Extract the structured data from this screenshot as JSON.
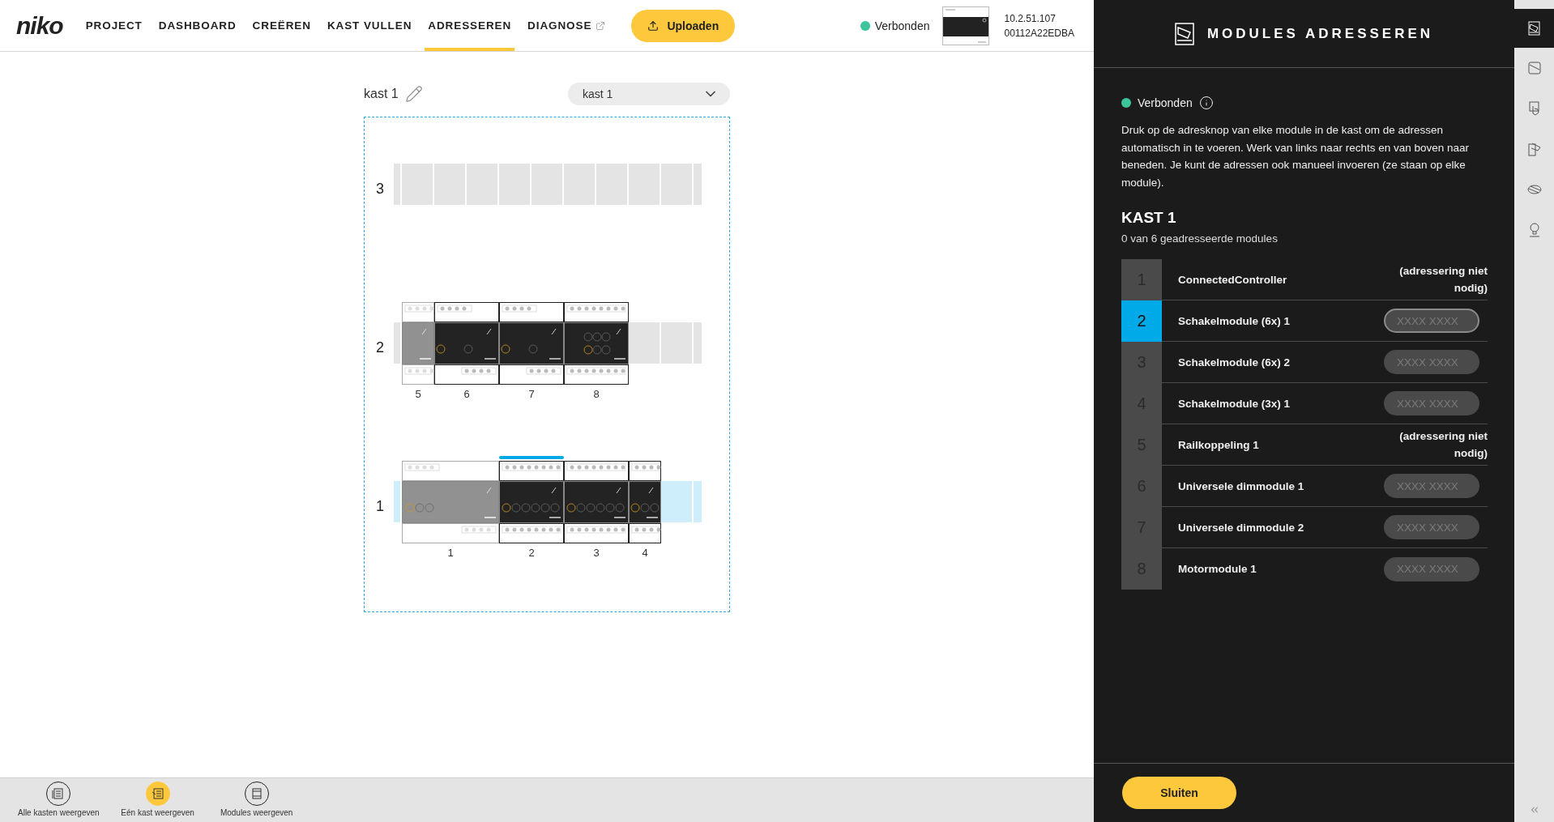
{
  "header": {
    "logo": "niko",
    "nav": [
      {
        "label": "PROJECT",
        "selected": false
      },
      {
        "label": "DASHBOARD",
        "selected": false
      },
      {
        "label": "CREËREN",
        "selected": false
      },
      {
        "label": "KAST VULLEN",
        "selected": false
      },
      {
        "label": "ADRESSEREN",
        "selected": true
      },
      {
        "label": "DIAGNOSE",
        "selected": false,
        "external": true
      }
    ],
    "upload_button": "Uploaden",
    "status": {
      "label": "Verbonden",
      "connected": true
    },
    "device": {
      "ip": "10.2.51.107",
      "id": "00112A22EDBA"
    }
  },
  "cabinet": {
    "title": "kast 1",
    "dropdown": "kast 1",
    "rails": [
      {
        "number": "3",
        "highlighted": false
      },
      {
        "number": "2",
        "highlighted": false,
        "modules": [
          {
            "number": "5",
            "kind": "coupler",
            "selected": false
          },
          {
            "number": "6",
            "kind": "dimmer",
            "selected": false
          },
          {
            "number": "7",
            "kind": "dimmer",
            "selected": false
          },
          {
            "number": "8",
            "kind": "motor",
            "selected": false
          }
        ]
      },
      {
        "number": "1",
        "highlighted": true,
        "modules": [
          {
            "number": "1",
            "kind": "controller",
            "selected": false
          },
          {
            "number": "2",
            "kind": "switch6",
            "selected": true
          },
          {
            "number": "3",
            "kind": "switch6",
            "selected": false
          },
          {
            "number": "4",
            "kind": "switch3",
            "selected": false
          }
        ]
      }
    ]
  },
  "view_bar": [
    {
      "label": "Alle kasten weergeven",
      "selected": false
    },
    {
      "label": "Eén kast weergeven",
      "selected": true
    },
    {
      "label": "Modules weergeven",
      "selected": false
    }
  ],
  "panel": {
    "title": "MODULES ADRESSEREN",
    "status": {
      "label": "Verbonden",
      "connected": true
    },
    "instructions": "Druk op de adresknop van elke module in de kast om de adressen automatisch in te voeren. Werk van links naar rechts en van boven naar beneden. Je kunt de adressen ook manueel invoeren (ze staan op elke module).",
    "cabinet_title": "KAST 1",
    "summary": "0 van 6 geadresseerde modules",
    "modules": [
      {
        "number": "1",
        "name": "ConnectedController",
        "selected": false,
        "kind": "note",
        "note": "(adressering niet nodig)"
      },
      {
        "number": "2",
        "name": "Schakelmodule (6x) 1",
        "selected": true,
        "kind": "address",
        "placeholder": "XXXX XXXX"
      },
      {
        "number": "3",
        "name": "Schakelmodule (6x) 2",
        "selected": false,
        "kind": "address",
        "placeholder": "XXXX XXXX"
      },
      {
        "number": "4",
        "name": "Schakelmodule (3x) 1",
        "selected": false,
        "kind": "address",
        "placeholder": "XXXX XXXX"
      },
      {
        "number": "5",
        "name": "Railkoppeling 1",
        "selected": false,
        "kind": "note",
        "note": "(adressering niet nodig)"
      },
      {
        "number": "6",
        "name": "Universele dimmodule 1",
        "selected": false,
        "kind": "address",
        "placeholder": "XXXX XXXX"
      },
      {
        "number": "7",
        "name": "Universele dimmodule 2",
        "selected": false,
        "kind": "address",
        "placeholder": "XXXX XXXX"
      },
      {
        "number": "8",
        "name": "Motormodule 1",
        "selected": false,
        "kind": "address",
        "placeholder": "XXXX XXXX"
      }
    ],
    "close_button": "Sluiten"
  },
  "side_toolbar": [
    {
      "selected": true
    },
    {
      "selected": false
    },
    {
      "selected": false
    },
    {
      "selected": false
    },
    {
      "selected": false
    },
    {
      "selected": false
    }
  ]
}
